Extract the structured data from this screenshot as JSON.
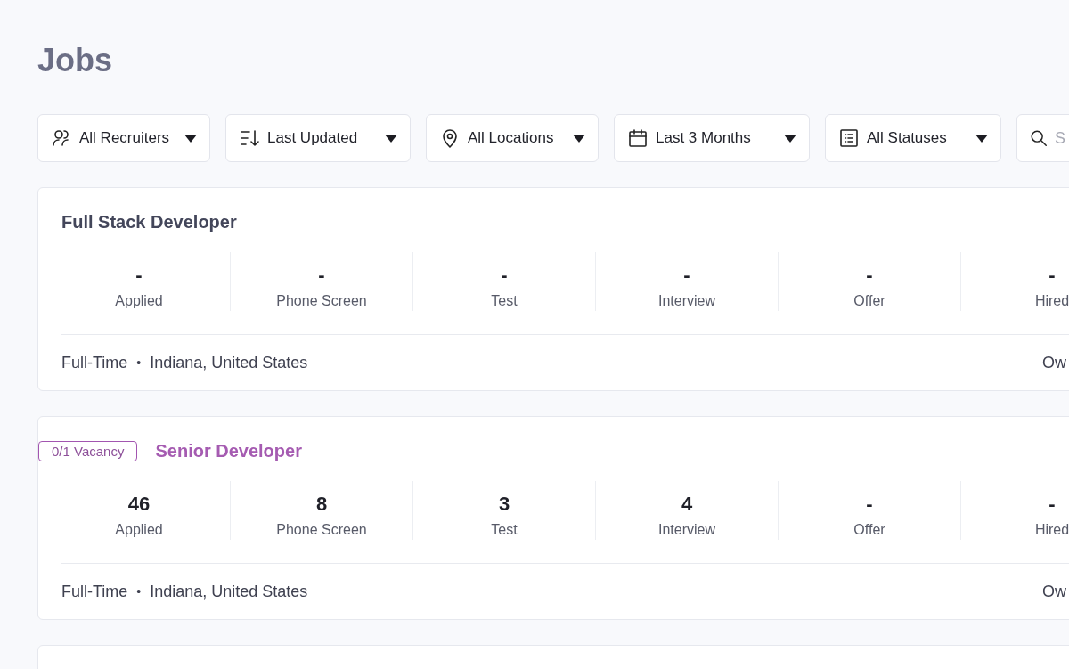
{
  "page_title": "Jobs",
  "filters": [
    {
      "label": "All Recruiters"
    },
    {
      "label": "Last Updated"
    },
    {
      "label": "All Locations"
    },
    {
      "label": "Last 3 Months"
    },
    {
      "label": "All Statuses"
    }
  ],
  "search": {
    "placeholder": "S"
  },
  "jobs": [
    {
      "title": "Full Stack Developer",
      "highlighted": false,
      "stages": [
        {
          "count": "-",
          "label": "Applied"
        },
        {
          "count": "-",
          "label": "Phone Screen"
        },
        {
          "count": "-",
          "label": "Test"
        },
        {
          "count": "-",
          "label": "Interview"
        },
        {
          "count": "-",
          "label": "Offer"
        },
        {
          "count": "-",
          "label": "Hired"
        }
      ],
      "type": "Full-Time",
      "separator": "•",
      "location": "Indiana, United States",
      "column_right": "Ow"
    },
    {
      "vacancy": "0/1 Vacancy",
      "title": "Senior Developer",
      "highlighted": true,
      "stages": [
        {
          "count": "46",
          "label": "Applied"
        },
        {
          "count": "8",
          "label": "Phone Screen"
        },
        {
          "count": "3",
          "label": "Test"
        },
        {
          "count": "4",
          "label": "Interview"
        },
        {
          "count": "-",
          "label": "Offer"
        },
        {
          "count": "-",
          "label": "Hired"
        }
      ],
      "type": "Full-Time",
      "separator": "•",
      "location": "Indiana, United States",
      "column_right": "Ow"
    }
  ]
}
